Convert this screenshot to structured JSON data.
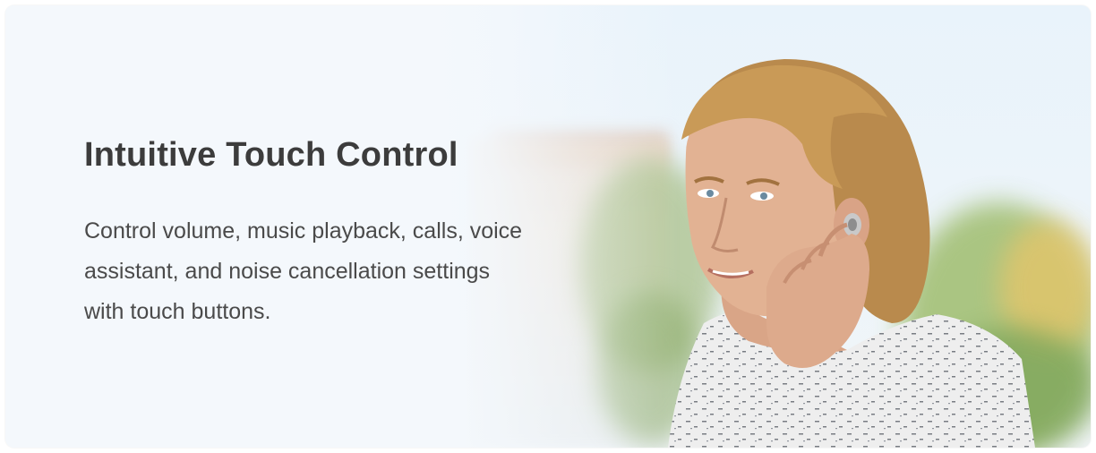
{
  "banner": {
    "headline": "Intuitive Touch Control",
    "description": "Control volume, music playback, calls, voice assistant, and noise cancellation settings with touch buttons."
  },
  "colors": {
    "headline": "#3c3c3c",
    "body_text": "#4a4a4a",
    "background": "#f2f7fb"
  },
  "image": {
    "subject": "person-touching-earbud"
  }
}
